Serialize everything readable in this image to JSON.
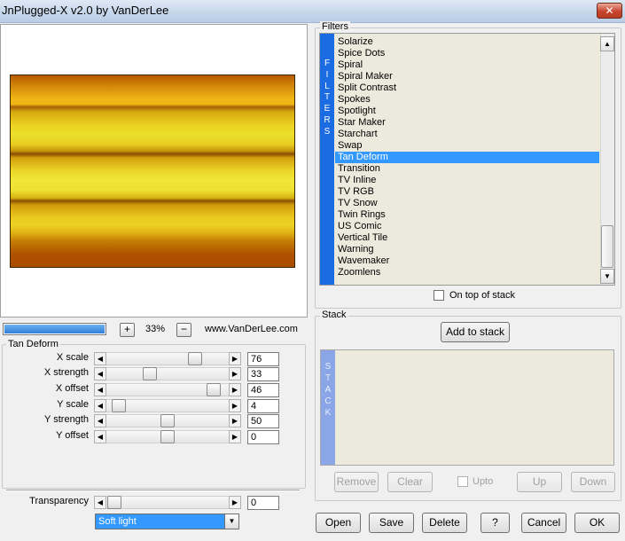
{
  "window": {
    "title": "JnPlugged-X v2.0 by VanDerLee",
    "close_label": "✕"
  },
  "zoom": {
    "progress": 1.0,
    "plus": "+",
    "minus": "−",
    "value": "33%",
    "website": "www.VanDerLee.com"
  },
  "params": {
    "group_label": "Tan Deform",
    "sliders": [
      {
        "label": "X scale",
        "value": "76",
        "pos": 0.76
      },
      {
        "label": "X strength",
        "value": "33",
        "pos": 0.33
      },
      {
        "label": "X offset",
        "value": "46",
        "pos": 0.93
      },
      {
        "label": "Y scale",
        "value": "4",
        "pos": 0.04
      },
      {
        "label": "Y strength",
        "value": "50",
        "pos": 0.5
      },
      {
        "label": "Y offset",
        "value": "0",
        "pos": 0.5
      }
    ]
  },
  "transparency": {
    "label": "Transparency",
    "value": "0",
    "pos": 0.0
  },
  "blend_mode": {
    "selected": "Soft light"
  },
  "filters": {
    "group_label": "Filters",
    "vertical_label": [
      "F",
      "I",
      "L",
      "T",
      "E",
      "R",
      "S"
    ],
    "items": [
      "Solarize",
      "Spice Dots",
      "Spiral",
      "Spiral Maker",
      "Split Contrast",
      "Spokes",
      "Spotlight",
      "Star Maker",
      "Starchart",
      "Swap",
      "Tan Deform",
      "Transition",
      "TV Inline",
      "TV RGB",
      "TV Snow",
      "Twin Rings",
      "US Comic",
      "Vertical Tile",
      "Warning",
      "Wavemaker",
      "Zoomlens"
    ],
    "selected": "Tan Deform",
    "on_top_label": "On top of stack"
  },
  "stack": {
    "group_label": "Stack",
    "add_label": "Add to stack",
    "vertical_label": [
      "S",
      "T",
      "A",
      "C",
      "K"
    ],
    "remove_label": "Remove",
    "clear_label": "Clear",
    "upto_label": "Upto",
    "up_label": "Up",
    "down_label": "Down"
  },
  "footer": {
    "open": "Open",
    "save": "Save",
    "delete": "Delete",
    "help": "?",
    "cancel": "Cancel",
    "ok": "OK"
  },
  "icons": {
    "arrow_left": "◀",
    "arrow_right": "▶",
    "arrow_up": "▲",
    "arrow_down": "▼"
  },
  "colors": {
    "accent": "#3399ff",
    "filters_bar": "#1b6be2",
    "stack_bar": "#8aa6e6",
    "list_bg": "#ece9dd"
  }
}
